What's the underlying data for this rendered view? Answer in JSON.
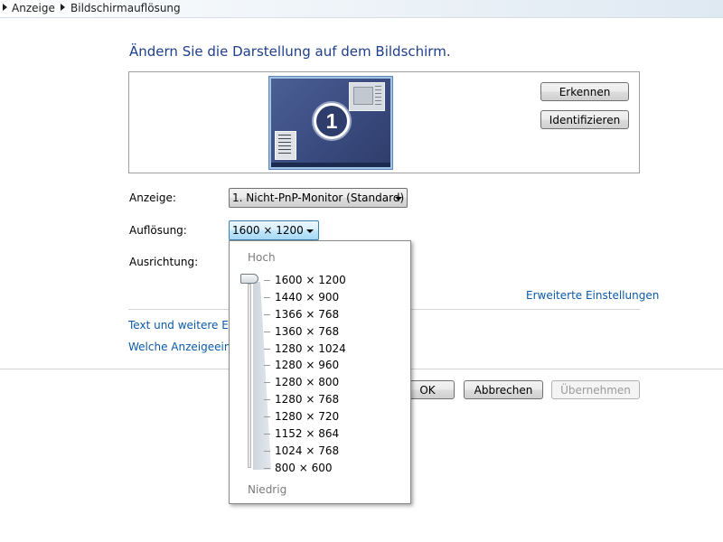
{
  "breadcrumb": [
    {
      "label": "Anzeige"
    },
    {
      "label": "Bildschirmauflösung"
    }
  ],
  "title": "Ändern Sie die Darstellung auf dem Bildschirm.",
  "preview": {
    "monitor_number": "1",
    "buttons": {
      "detect": "Erkennen",
      "identify": "Identifizieren"
    }
  },
  "settings": {
    "display_label": "Anzeige:",
    "display_value": "1. Nicht-PnP-Monitor (Standard)",
    "resolution_label": "Auflösung:",
    "resolution_value": "1600 × 1200",
    "orientation_label": "Ausrichtung:"
  },
  "advanced_link": "Erweiterte Einstellungen",
  "links": {
    "text_size": "Text und weitere Elen",
    "which_settings": "Welche Anzeigeeinste"
  },
  "resolution_dropdown": {
    "high_label": "Hoch",
    "low_label": "Niedrig",
    "selected_index": 0,
    "options": [
      "1600 × 1200",
      "1440 × 900",
      "1366 × 768",
      "1360 × 768",
      "1280 × 1024",
      "1280 × 960",
      "1280 × 800",
      "1280 × 768",
      "1280 × 720",
      "1152 × 864",
      "1024 × 768",
      "800 × 600"
    ]
  },
  "footer": {
    "ok": "OK",
    "cancel": "Abbrechen",
    "apply": "Übernehmen",
    "apply_enabled": false
  },
  "colors": {
    "title": "#1e3f8b",
    "link": "#0b5aa8",
    "monitor_bg": "#3a4b7f"
  }
}
